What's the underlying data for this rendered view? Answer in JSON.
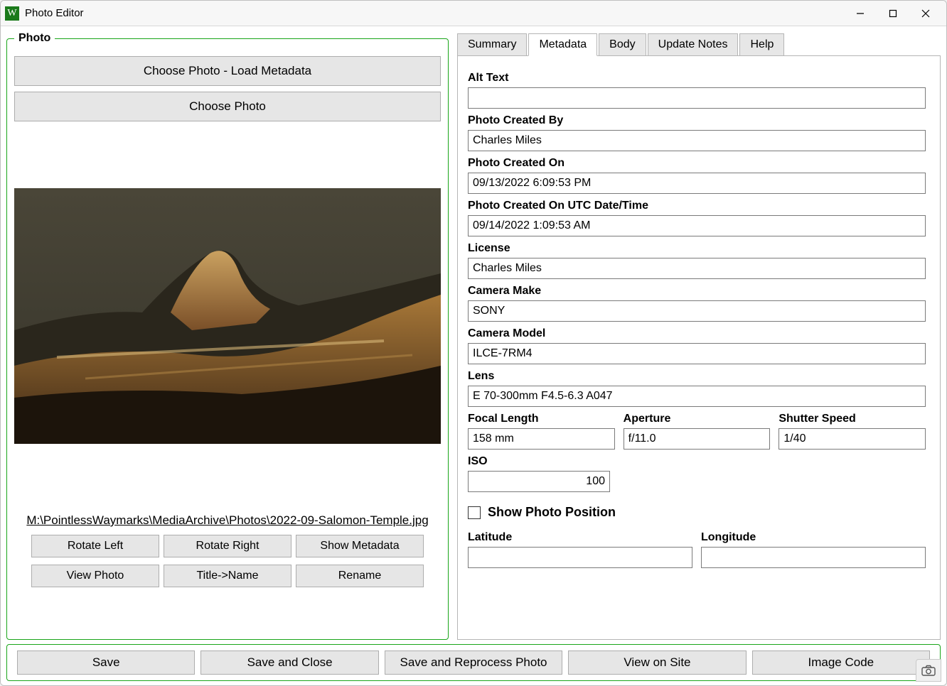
{
  "window": {
    "title": "Photo Editor",
    "app_icon_letter": "W"
  },
  "photo_panel": {
    "legend": "Photo",
    "choose_load_btn": "Choose Photo - Load Metadata",
    "choose_btn": "Choose Photo",
    "file_path": "M:\\PointlessWaymarks\\MediaArchive\\Photos\\2022-09-Salomon-Temple.jpg",
    "buttons": {
      "rotate_left": "Rotate Left",
      "rotate_right": "Rotate Right",
      "show_metadata": "Show Metadata",
      "view_photo": "View Photo",
      "title_name": "Title->Name",
      "rename": "Rename"
    }
  },
  "tabs": {
    "summary": "Summary",
    "metadata": "Metadata",
    "body": "Body",
    "update_notes": "Update Notes",
    "help": "Help"
  },
  "metadata": {
    "alt_text_label": "Alt Text",
    "alt_text": "",
    "created_by_label": "Photo Created By",
    "created_by": "Charles Miles",
    "created_on_label": "Photo Created On",
    "created_on": "09/13/2022 6:09:53 PM",
    "created_on_utc_label": "Photo Created On UTC Date/Time",
    "created_on_utc": "09/14/2022 1:09:53 AM",
    "license_label": "License",
    "license": "Charles Miles",
    "camera_make_label": "Camera Make",
    "camera_make": "SONY",
    "camera_model_label": "Camera Model",
    "camera_model": "ILCE-7RM4",
    "lens_label": "Lens",
    "lens": "E 70-300mm F4.5-6.3 A047",
    "focal_length_label": "Focal Length",
    "focal_length": "158 mm",
    "aperture_label": "Aperture",
    "aperture": "f/11.0",
    "shutter_speed_label": "Shutter Speed",
    "shutter_speed": "1/40",
    "iso_label": "ISO",
    "iso": "100",
    "show_position_label": "Show Photo Position",
    "show_position_checked": false,
    "latitude_label": "Latitude",
    "latitude": "",
    "longitude_label": "Longitude",
    "longitude": ""
  },
  "bottom": {
    "save": "Save",
    "save_close": "Save and Close",
    "save_reprocess": "Save and Reprocess Photo",
    "view_on_site": "View on Site",
    "image_code": "Image Code"
  }
}
